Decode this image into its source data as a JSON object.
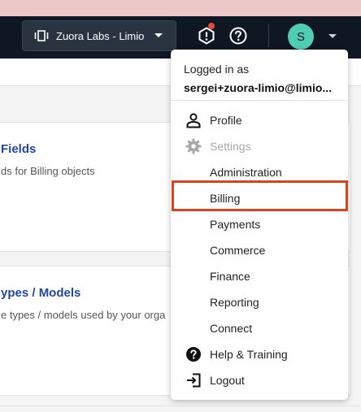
{
  "topbar": {
    "tenant_label": "Zuora Labs - Limio",
    "avatar_initial": "S",
    "icons": [
      "tenant-switch-icon",
      "notification-alert-icon",
      "help-icon",
      "chevron-down-icon"
    ]
  },
  "cards": [
    {
      "title": "Fields",
      "description": "ds for Billing objects"
    },
    {
      "title": "ypes / Models",
      "description": "e types / models used by your orga"
    }
  ],
  "user_menu": {
    "logged_in_label": "Logged in as",
    "email": "sergei+zuora-limio@limio...",
    "items": [
      {
        "label": "Profile",
        "icon": "person-icon",
        "enabled": true
      },
      {
        "label": "Settings",
        "icon": "gear-icon",
        "enabled": false
      },
      {
        "label": "Administration",
        "icon": "",
        "enabled": true
      },
      {
        "label": "Billing",
        "icon": "",
        "enabled": true,
        "highlighted": true
      },
      {
        "label": "Payments",
        "icon": "",
        "enabled": true
      },
      {
        "label": "Commerce",
        "icon": "",
        "enabled": true
      },
      {
        "label": "Finance",
        "icon": "",
        "enabled": true
      },
      {
        "label": "Reporting",
        "icon": "",
        "enabled": true
      },
      {
        "label": "Connect",
        "icon": "",
        "enabled": true
      },
      {
        "label": "Help & Training",
        "icon": "help-circle-icon",
        "enabled": true
      },
      {
        "label": "Logout",
        "icon": "logout-icon",
        "enabled": true
      }
    ]
  },
  "colors": {
    "navbar": "#0f1723",
    "top_strip": "#ecc8c9",
    "avatar": "#4ecdb2",
    "link": "#2148a7",
    "highlight_border": "#d9441f",
    "notification_dot": "#e24b3b"
  }
}
